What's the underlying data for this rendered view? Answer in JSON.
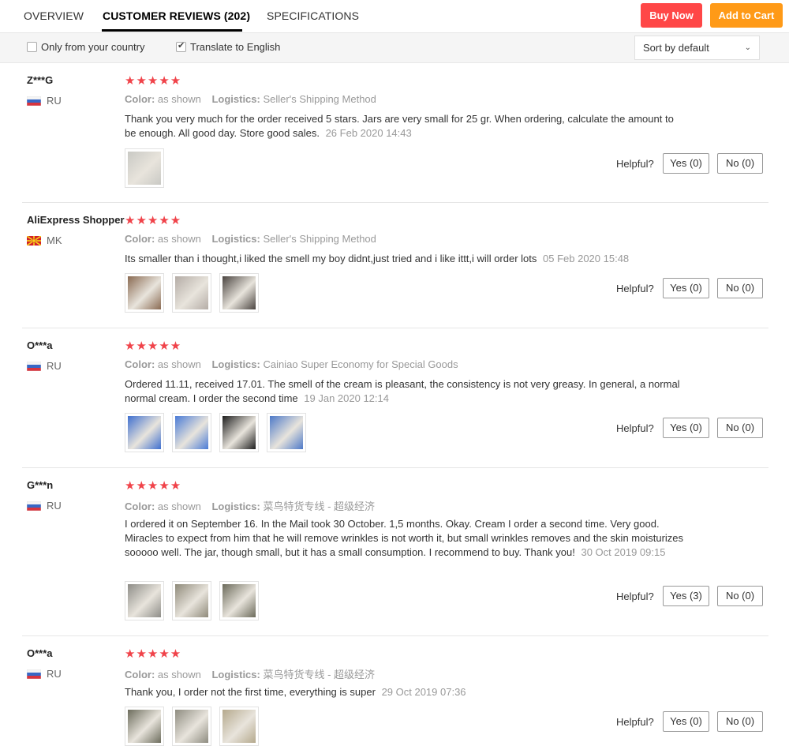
{
  "tabs": {
    "overview": "OVERVIEW",
    "reviews": "CUSTOMER REVIEWS (202)",
    "specifications": "SPECIFICATIONS"
  },
  "actions": {
    "buy_now": "Buy Now",
    "add_to_cart": "Add to Cart"
  },
  "filters": {
    "only_country": "Only from your country",
    "only_country_checked": false,
    "translate": "Translate to English",
    "translate_checked": true,
    "sort": "Sort by default"
  },
  "labels": {
    "color": "Color:",
    "logistics": "Logistics:",
    "helpful": "Helpful?",
    "stars": "★★★★★"
  },
  "reviews": [
    {
      "user": "Z***G",
      "country": "RU",
      "flag": "ru",
      "color": "as shown",
      "logistics": "Seller's Shipping Method",
      "text": "Thank you very much for the order received 5 stars. Jars are very small for 25 gr. When ordering, calculate the amount to be enough. All good day. Store good sales.",
      "date": "26 Feb 2020 14:43",
      "yes": "Yes (0)",
      "no": "No (0)",
      "thumbs": [
        "#c9c9c4"
      ]
    },
    {
      "user": "AliExpress Shopper",
      "country": "MK",
      "flag": "mk",
      "color": "as shown",
      "logistics": "Seller's Shipping Method",
      "text": "Its smaller than i thought,i liked the smell my boy didnt,just tried and i like ittt,i will order lots",
      "date": "05 Feb 2020 15:48",
      "yes": "Yes (0)",
      "no": "No (0)",
      "thumbs": [
        "#8a6a52",
        "#b4aca6",
        "#4a4440"
      ]
    },
    {
      "user": "O***a",
      "country": "RU",
      "flag": "ru",
      "color": "as shown",
      "logistics": "Cainiao Super Economy for Special Goods",
      "text": "Ordered 11.11, received 17.01. The smell of the cream is pleasant, the consistency is not very greasy. In general, a normal normal cream. I order the second time",
      "date": "19 Jan 2020 12:14",
      "yes": "Yes (0)",
      "no": "No (0)",
      "thumbs": [
        "#3f6fcf",
        "#4a7bd6",
        "#1d1d1d",
        "#4d79c8"
      ]
    },
    {
      "user": "G***n",
      "country": "RU",
      "flag": "ru",
      "color": "as shown",
      "logistics": "菜鸟特货专线 - 超级经济",
      "text": "I ordered it on September 16. In the Mail took 30 October. 1,5 months. Okay. Cream I order a second time. Very good. Miracles to expect from him that he will remove wrinkles is not worth it, but small wrinkles removes and the skin moisturizes sooooo well. The jar, though small, but it has a small consumption. I recommend to buy. Thank you!",
      "date": "30 Oct 2019 09:15",
      "yes": "Yes (3)",
      "no": "No (0)",
      "thumbs": [
        "#8e8d88",
        "#8f8a7a",
        "#6b6a5a"
      ]
    },
    {
      "user": "O***a",
      "country": "RU",
      "flag": "ru",
      "color": "as shown",
      "logistics": "菜鸟特货专线 - 超级经济",
      "text": "Thank you, I order not the first time, everything is super",
      "date": "29 Oct 2019 07:36",
      "yes": "Yes (0)",
      "no": "No (0)",
      "thumbs": [
        "#6c6c5c",
        "#8e8c80",
        "#b5a98d"
      ]
    }
  ]
}
